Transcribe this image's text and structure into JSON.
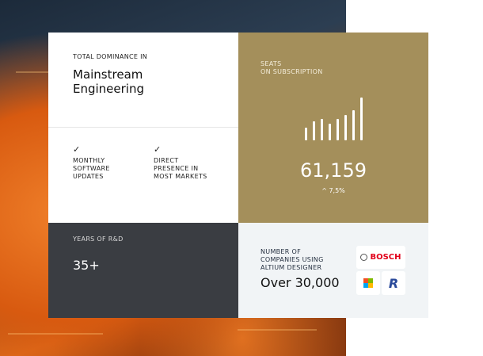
{
  "dominance": {
    "label": "TOTAL DOMINANCE IN",
    "title_line1": "Mainstream",
    "title_line2": "Engineering"
  },
  "features": [
    {
      "icon": "check-icon",
      "lines": [
        "MONTHLY",
        "SOFTWARE",
        "UPDATES"
      ]
    },
    {
      "icon": "check-icon",
      "lines": [
        "DIRECT",
        "PRESENCE IN",
        "MOST MARKETS"
      ]
    }
  ],
  "seats": {
    "label_line1": "SEATS",
    "label_line2": "ON SUBSCRIPTION",
    "value": "61,159",
    "change": "7,5%",
    "change_icon": "caret-up-icon",
    "trend": [
      47,
      70,
      80,
      62,
      80,
      95,
      112,
      160
    ]
  },
  "rnd": {
    "label": "YEARS OF R&D",
    "value": "35+"
  },
  "companies": {
    "label_lines": [
      "NUMBER OF",
      "COMPANIES USING",
      "ALTIUM DESIGNER"
    ],
    "value": "Over 30,000",
    "logos": {
      "bosch": "BOSCH",
      "r": "R"
    }
  },
  "colors": {
    "gold": "#a48f5b",
    "dark": "#3a3d42",
    "light": "#f1f4f6"
  }
}
